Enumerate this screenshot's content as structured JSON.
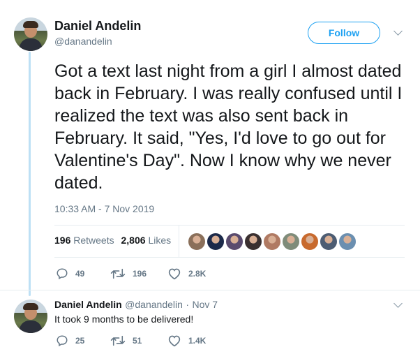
{
  "tweet": {
    "author_name": "Daniel Andelin",
    "author_handle": "@danandelin",
    "follow_label": "Follow",
    "text": "Got a text last night from a girl I almost dated back in February. I was really confused until I realized the text was also sent back in February. It said, \"Yes, I'd love to go out for Valentine's Day\". Now I know why we never dated.",
    "timestamp": "10:33 AM - 7 Nov 2019",
    "retweets_count": "196",
    "retweets_label": "Retweets",
    "likes_count": "2,806",
    "likes_label": "Likes",
    "actions": {
      "replies": "49",
      "retweets": "196",
      "likes": "2.8K"
    }
  },
  "reply": {
    "author_name": "Daniel Andelin",
    "author_handle": "@danandelin",
    "separator": "·",
    "date": "Nov 7",
    "text": "It took 9 months to be delivered!",
    "actions": {
      "replies": "25",
      "retweets": "51",
      "likes": "1.4K"
    }
  },
  "icons": {
    "reply": "reply-icon",
    "retweet": "retweet-icon",
    "like": "heart-icon",
    "more": "chevron-down-icon"
  },
  "colors": {
    "accent": "#1da1f2",
    "thread_line": "#bde0f5",
    "muted": "#657786",
    "text": "#14171a"
  },
  "likers": [
    {
      "color": "#8a6f5a"
    },
    {
      "color": "#1c2a4a"
    },
    {
      "color": "#5a4b6e"
    },
    {
      "color": "#3a3030"
    },
    {
      "color": "#b07a63"
    },
    {
      "color": "#7f8c7a"
    },
    {
      "color": "#c86a2e"
    },
    {
      "color": "#4d5d73"
    },
    {
      "color": "#6b8fb0"
    }
  ]
}
